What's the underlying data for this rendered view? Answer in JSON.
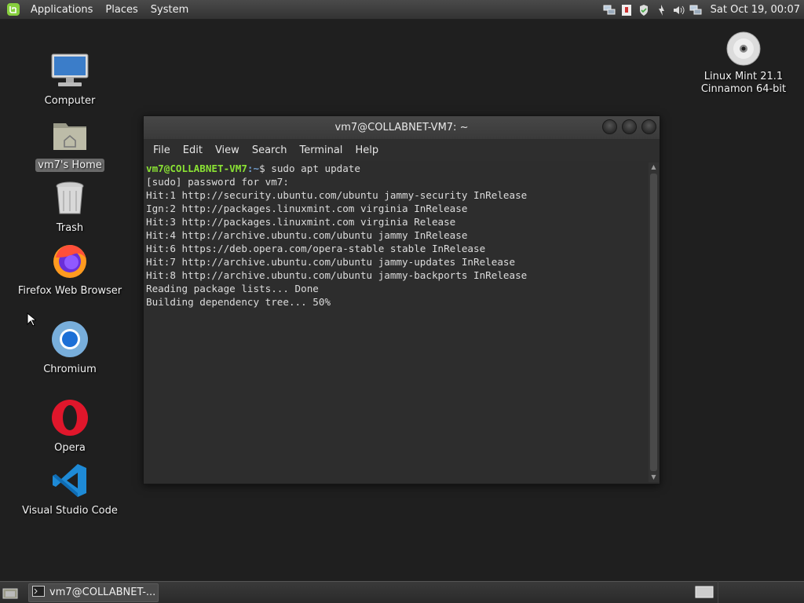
{
  "top_panel": {
    "menus": [
      "Applications",
      "Places",
      "System"
    ],
    "clock": "Sat Oct 19, 00:07"
  },
  "desktop": {
    "icons": [
      {
        "label": "Computer"
      },
      {
        "label": "vm7's Home"
      },
      {
        "label": "Trash"
      },
      {
        "label": "Firefox Web Browser"
      },
      {
        "label": "Chromium"
      },
      {
        "label": "Opera"
      },
      {
        "label": "Visual Studio Code"
      }
    ],
    "disc": {
      "line1": "Linux Mint 21.1",
      "line2": "Cinnamon 64-bit"
    }
  },
  "terminal": {
    "title": "vm7@COLLABNET-VM7: ~",
    "menu": [
      "File",
      "Edit",
      "View",
      "Search",
      "Terminal",
      "Help"
    ],
    "prompt_user": "vm7@COLLABNET-VM7",
    "prompt_path": ":~",
    "prompt_cmd": "$ sudo apt update",
    "lines": [
      "[sudo] password for vm7:",
      "Hit:1 http://security.ubuntu.com/ubuntu jammy-security InRelease",
      "Ign:2 http://packages.linuxmint.com virginia InRelease",
      "Hit:3 http://packages.linuxmint.com virginia Release",
      "Hit:4 http://archive.ubuntu.com/ubuntu jammy InRelease",
      "Hit:6 https://deb.opera.com/opera-stable stable InRelease",
      "Hit:7 http://archive.ubuntu.com/ubuntu jammy-updates InRelease",
      "Hit:8 http://archive.ubuntu.com/ubuntu jammy-backports InRelease",
      "Reading package lists... Done",
      "Building dependency tree... 50%"
    ]
  },
  "taskbar": {
    "window_label": "vm7@COLLABNET-..."
  },
  "colors": {
    "prompt_user": "#8ae234",
    "prompt_path": "#729fcf",
    "desktop_bg": "#1f1f1f"
  }
}
